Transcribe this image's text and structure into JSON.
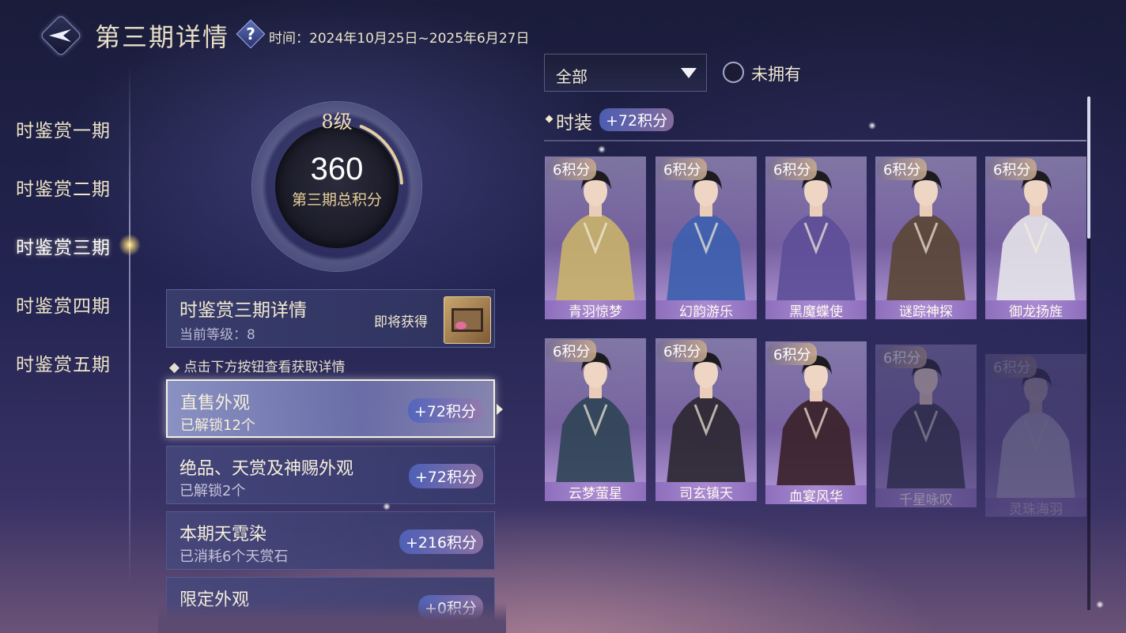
{
  "header": {
    "title": "第三期详情",
    "time_label": "时间：2024年10月25日~2025年6月27日"
  },
  "sidebar": {
    "items": [
      {
        "label": "时鉴赏一期"
      },
      {
        "label": "时鉴赏二期"
      },
      {
        "label": "时鉴赏三期"
      },
      {
        "label": "时鉴赏四期"
      },
      {
        "label": "时鉴赏五期"
      }
    ],
    "active_index": 2
  },
  "score": {
    "level": "8级",
    "total": "360",
    "caption": "第三期总积分",
    "ring_progress": 0.18
  },
  "detail": {
    "title": "时鉴赏三期详情",
    "current_level": "当前等级：8",
    "soon_label": "即将获得"
  },
  "hint": "点击下方按钮查看获取详情",
  "categories": [
    {
      "name": "直售外观",
      "sub": "已解锁12个",
      "points": "+72积分"
    },
    {
      "name": "绝品、天赏及神赐外观",
      "sub": "已解锁2个",
      "points": "+72积分"
    },
    {
      "name": "本期天霓染",
      "sub": "已消耗6个天赏石",
      "points": "+216积分"
    },
    {
      "name": "限定外观",
      "sub": "",
      "points": "+0积分"
    }
  ],
  "filter": {
    "selected": "全部",
    "unowned_label": "未拥有"
  },
  "section": {
    "title": "时装",
    "points": "+72积分"
  },
  "outfits": [
    {
      "badge": "6积分",
      "name": "青羽惊梦",
      "color": "#c9b36a"
    },
    {
      "badge": "6积分",
      "name": "幻韵游乐",
      "color": "#3c5fae"
    },
    {
      "badge": "6积分",
      "name": "黑魔蝶使",
      "color": "#5d4e98"
    },
    {
      "badge": "6积分",
      "name": "谜踪神探",
      "color": "#5a4635"
    },
    {
      "badge": "6积分",
      "name": "御龙扬旌",
      "color": "#e6e4ea"
    },
    {
      "badge": "6积分",
      "name": "云梦萤星",
      "color": "#2e4455"
    },
    {
      "badge": "6积分",
      "name": "司玄镇天",
      "color": "#2a2630"
    },
    {
      "badge": "6积分",
      "name": "血宴风华",
      "color": "#3a2028"
    },
    {
      "badge": "6积分",
      "name": "千星咏叹",
      "color": "#2b2b3a"
    },
    {
      "badge": "6积分",
      "name": "灵珠海羽",
      "color": "#eae6ef"
    }
  ]
}
